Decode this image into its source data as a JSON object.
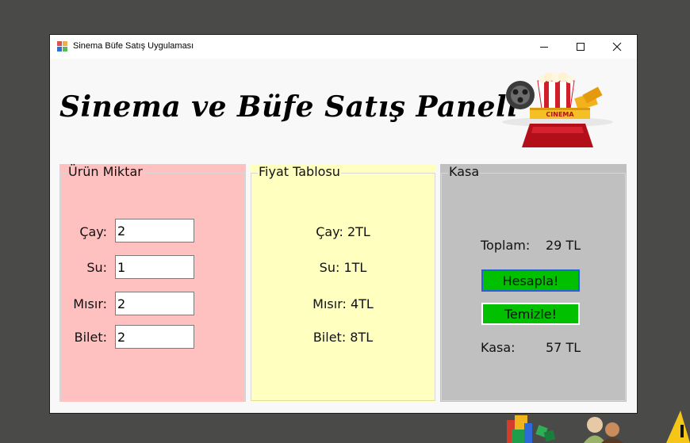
{
  "window": {
    "title": "Sinema Büfe Satış Uygulaması",
    "minimize_icon": "minimize-icon",
    "maximize_icon": "maximize-icon",
    "close_icon": "close-icon"
  },
  "header": {
    "title": "Sinema ve Büfe Satış Paneli",
    "logo_text": "CINEMA"
  },
  "urun_miktar": {
    "group_title": "Ürün Miktar",
    "rows": [
      {
        "label": "Çay:",
        "value": "2"
      },
      {
        "label": "Su:",
        "value": "1"
      },
      {
        "label": "Mısır:",
        "value": "2"
      },
      {
        "label": "Bilet:",
        "value": "2"
      }
    ]
  },
  "fiyat_tablosu": {
    "group_title": "Fiyat Tablosu",
    "prices": [
      "Çay: 2TL",
      "Su: 1TL",
      "Mısır: 4TL",
      "Bilet: 8TL"
    ]
  },
  "kasa": {
    "group_title": "Kasa",
    "toplam_label": "Toplam:",
    "toplam_value": "29 TL",
    "hesapla_button": "Hesapla!",
    "temizle_button": "Temizle!",
    "kasa_label": "Kasa:",
    "kasa_value": "57 TL"
  },
  "colors": {
    "panel_urun": "#ffc0c0",
    "panel_fiyat": "#ffffc0",
    "panel_kasa": "#c0c0c0",
    "button": "#00c000",
    "desktop": "#4a4a48"
  }
}
